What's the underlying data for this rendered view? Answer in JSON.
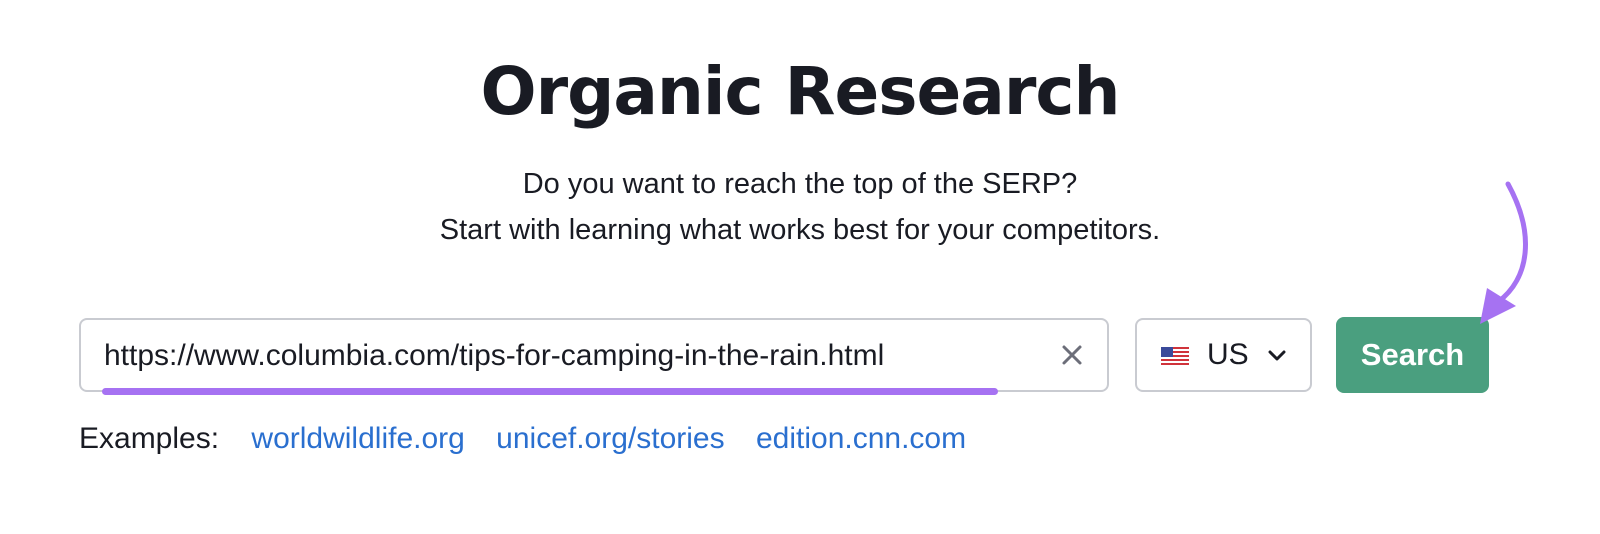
{
  "page": {
    "title": "Organic Research",
    "subtitle_line1": "Do you want to reach the top of the SERP?",
    "subtitle_line2": "Start with learning what works best for your competitors."
  },
  "search": {
    "value": "https://www.columbia.com/tips-for-camping-in-the-rain.html",
    "clear_icon": "close-icon",
    "button_label": "Search"
  },
  "country": {
    "selected": "US",
    "flag_icon": "us-flag-icon",
    "chevron_icon": "chevron-down-icon"
  },
  "examples": {
    "label": "Examples:",
    "links": [
      "worldwildlife.org",
      "unicef.org/stories",
      "edition.cnn.com"
    ]
  },
  "colors": {
    "accent_button": "#4a9f7f",
    "link": "#2a6fcf",
    "annotation": "#a672f2"
  }
}
